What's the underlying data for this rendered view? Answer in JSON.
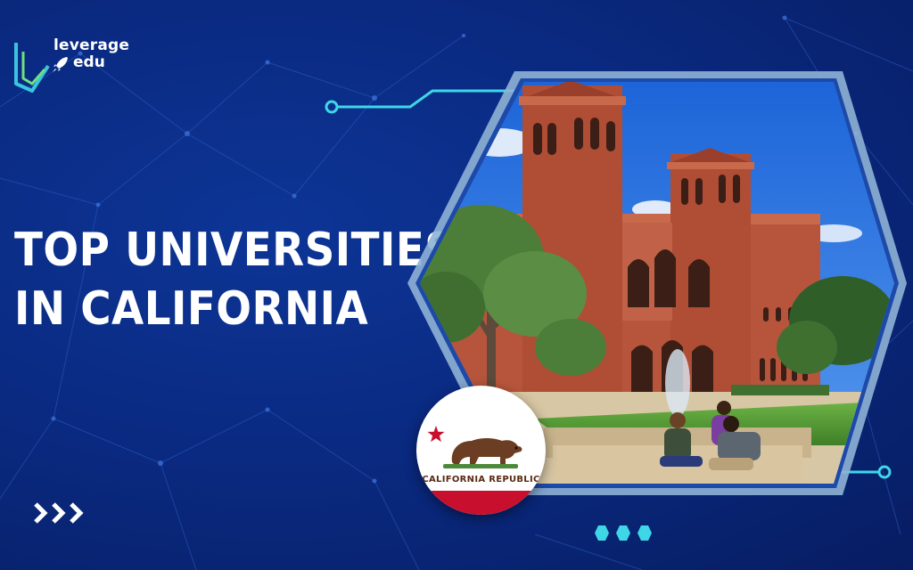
{
  "logo": {
    "line1": "leverage",
    "line2": "edu"
  },
  "headline": {
    "line1": "TOP UNIVERSITIES",
    "line2": "IN CALIFORNIA"
  },
  "flag": {
    "text": "CALIFORNIA REPUBLIC"
  },
  "colors": {
    "background": "#0a2a82",
    "accent_cyan": "#3fd6e8",
    "hex_frame": "#8fb3d6",
    "brick": "#b7553c",
    "sky": "#1f6fe0",
    "lawn": "#5ea33a",
    "flag_red": "#c8102e"
  },
  "icons": {
    "logo": "leverage-edu-v-mark",
    "rocket": "rocket-icon",
    "bear": "bear-icon",
    "star": "star-icon",
    "chevrons": "triple-chevron-right-icon",
    "dots": "three-hexagon-dots-icon"
  }
}
